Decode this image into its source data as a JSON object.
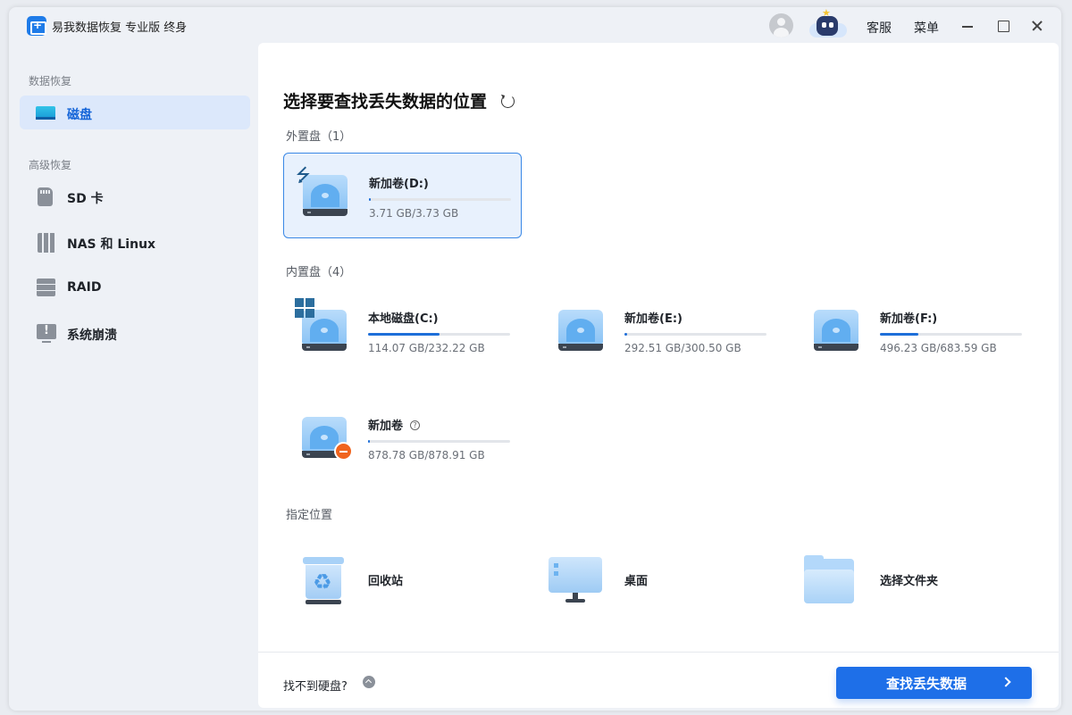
{
  "app": {
    "title": "易我数据恢复 专业版 终身",
    "links": {
      "service": "客服",
      "menu": "菜单"
    }
  },
  "sidebar": {
    "sections": [
      "数据恢复",
      "高级恢复"
    ],
    "items": [
      {
        "label": "磁盘",
        "icon": "disk-icon",
        "active": true
      },
      {
        "label": "SD 卡",
        "icon": "sd-card-icon"
      },
      {
        "label": "NAS 和 Linux",
        "icon": "nas-icon"
      },
      {
        "label": "RAID",
        "icon": "raid-icon"
      },
      {
        "label": "系统崩溃",
        "icon": "system-crash-icon"
      }
    ]
  },
  "main": {
    "title": "选择要查找丢失数据的位置",
    "external": {
      "label": "外置盘（1）",
      "drives": [
        {
          "name": "新加卷(D:)",
          "size": "3.71 GB/3.73 GB",
          "usage": 0.01,
          "badge": "usb-icon",
          "selected": true
        }
      ]
    },
    "internal": {
      "label": "内置盘（4）",
      "drives": [
        {
          "name": "本地磁盘(C:)",
          "size": "114.07 GB/232.22 GB",
          "usage": 0.5,
          "badge": "windows-icon"
        },
        {
          "name": "新加卷(E:)",
          "size": "292.51 GB/300.50 GB",
          "usage": 0.02
        },
        {
          "name": "新加卷(F:)",
          "size": "496.23 GB/683.59 GB",
          "usage": 0.27
        },
        {
          "name": "新加卷",
          "size": "878.78 GB/878.91 GB",
          "usage": 0.01,
          "badge": "no-entry-icon",
          "help": "?"
        }
      ]
    },
    "locations": {
      "label": "指定位置",
      "items": [
        {
          "name": "回收站",
          "icon": "recycle-bin-icon"
        },
        {
          "name": "桌面",
          "icon": "desktop-icon"
        },
        {
          "name": "选择文件夹",
          "icon": "folder-icon"
        }
      ]
    },
    "footer": {
      "not_found": "找不到硬盘?",
      "scan_button": "查找丢失数据"
    }
  },
  "colors": {
    "accent": "#1e6fe8",
    "usage_bar": "#1e6fd9",
    "selected_bg": "#e8f1fd",
    "sidebar_active_bg": "#dce8fb",
    "warning": "#f0641e"
  }
}
